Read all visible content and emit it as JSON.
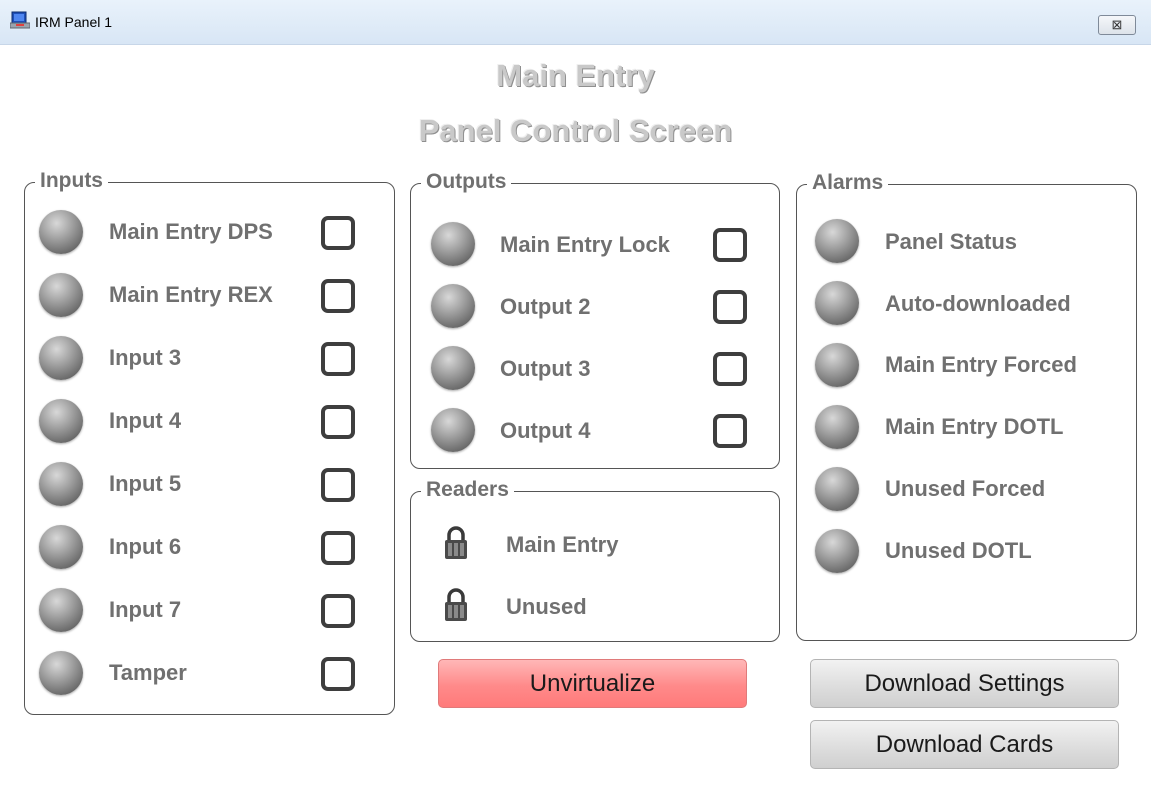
{
  "window": {
    "title": "IRM Panel 1",
    "close_glyph": "⊠",
    "close_icon": "close-icon"
  },
  "heading": {
    "line1": "Main Entry",
    "line2": "Panel Control Screen"
  },
  "inputs": {
    "legend": "Inputs",
    "items": [
      {
        "label": "Main Entry DPS",
        "checked": false
      },
      {
        "label": "Main Entry REX",
        "checked": false
      },
      {
        "label": "Input 3",
        "checked": false
      },
      {
        "label": "Input 4",
        "checked": false
      },
      {
        "label": "Input 5",
        "checked": false
      },
      {
        "label": "Input 6",
        "checked": false
      },
      {
        "label": "Input 7",
        "checked": false
      },
      {
        "label": "Tamper",
        "checked": false
      }
    ]
  },
  "outputs": {
    "legend": "Outputs",
    "items": [
      {
        "label": "Main Entry Lock",
        "checked": false
      },
      {
        "label": "Output 2",
        "checked": false
      },
      {
        "label": "Output 3",
        "checked": false
      },
      {
        "label": "Output 4",
        "checked": false
      }
    ]
  },
  "readers": {
    "legend": "Readers",
    "items": [
      {
        "label": "Main Entry",
        "icon": "lock-icon"
      },
      {
        "label": "Unused",
        "icon": "lock-icon"
      }
    ]
  },
  "alarms": {
    "legend": "Alarms",
    "items": [
      {
        "label": "Panel Status"
      },
      {
        "label": "Auto-downloaded"
      },
      {
        "label": "Main Entry Forced"
      },
      {
        "label": "Main Entry DOTL"
      },
      {
        "label": "Unused Forced"
      },
      {
        "label": "Unused DOTL"
      }
    ]
  },
  "buttons": {
    "unvirtualize": "Unvirtualize",
    "download_settings": "Download Settings",
    "download_cards": "Download Cards"
  },
  "colors": {
    "led_off": "#8a8a8a",
    "unvirtualize_bg": "#ff8a8a",
    "group_text": "#707070"
  }
}
